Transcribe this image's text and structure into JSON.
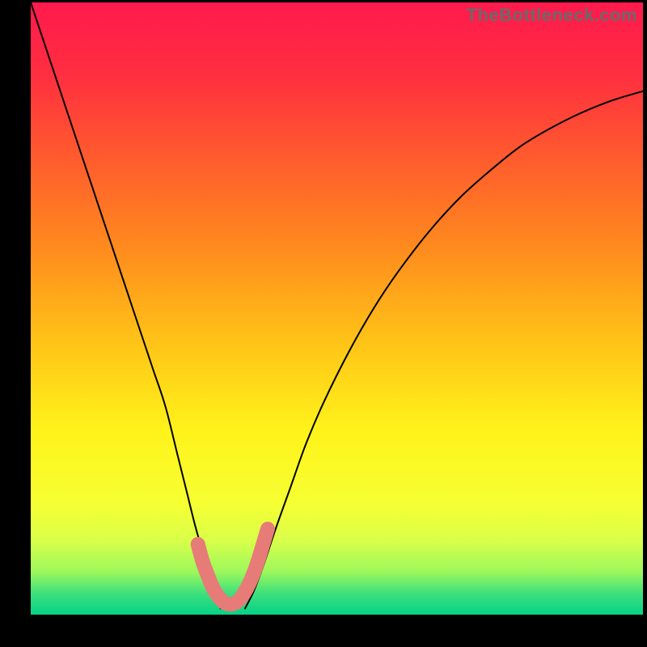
{
  "watermark": "TheBottleneck.com",
  "gradient": {
    "stops": [
      {
        "offset": 0.0,
        "color": "#ff1a4d"
      },
      {
        "offset": 0.12,
        "color": "#ff2f3f"
      },
      {
        "offset": 0.25,
        "color": "#ff5a2e"
      },
      {
        "offset": 0.4,
        "color": "#ff8a1e"
      },
      {
        "offset": 0.55,
        "color": "#ffc217"
      },
      {
        "offset": 0.7,
        "color": "#fff31a"
      },
      {
        "offset": 0.82,
        "color": "#f6ff33"
      },
      {
        "offset": 0.88,
        "color": "#d8ff4a"
      },
      {
        "offset": 0.93,
        "color": "#9cf85b"
      },
      {
        "offset": 0.965,
        "color": "#3fe07c"
      },
      {
        "offset": 1.0,
        "color": "#05d387"
      }
    ]
  },
  "chart_data": {
    "type": "line",
    "title": "",
    "xlabel": "",
    "ylabel": "",
    "xlim": [
      0,
      100
    ],
    "ylim": [
      0,
      100
    ],
    "grid": false,
    "legend": false,
    "series": [
      {
        "name": "curve-left",
        "style": "thin-black",
        "x": [
          0,
          2,
          4,
          6,
          8,
          10,
          12,
          14,
          16,
          18,
          20,
          22,
          24,
          25.5,
          27,
          28.5,
          30,
          31
        ],
        "y": [
          100,
          94,
          88,
          82,
          76,
          70,
          64,
          58,
          52,
          46,
          40,
          34,
          26,
          20,
          14,
          9,
          4,
          1
        ]
      },
      {
        "name": "curve-right",
        "style": "thin-black",
        "x": [
          35,
          36.5,
          38,
          40,
          42.5,
          45,
          48,
          52,
          56,
          60,
          65,
          70,
          75,
          80,
          85,
          90,
          95,
          100
        ],
        "y": [
          1,
          4,
          8,
          14,
          21,
          28,
          35,
          43,
          50,
          56,
          62.5,
          68,
          72.5,
          76.5,
          79.5,
          82,
          84,
          85.5
        ]
      },
      {
        "name": "well-highlight",
        "style": "thick-salmon",
        "x": [
          27.3,
          28.1,
          29.0,
          29.8,
          30.7,
          31.6,
          32.5,
          33.4,
          34.3,
          35.2,
          36.1,
          37.0,
          37.8,
          38.7
        ],
        "y": [
          11.5,
          8.6,
          6.2,
          4.3,
          2.9,
          2.0,
          1.7,
          1.9,
          2.7,
          4.1,
          6.0,
          8.4,
          11.0,
          14.0
        ]
      }
    ],
    "annotations": [
      {
        "text": "TheBottleneck.com",
        "role": "watermark",
        "position": "top-right"
      }
    ]
  }
}
